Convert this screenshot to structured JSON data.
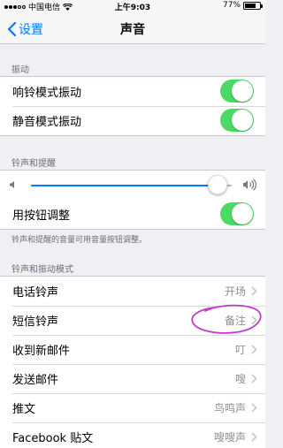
{
  "status_bar": {
    "carrier": "中国电信",
    "signal": "signal-dots-icon",
    "wifi": "wifi-icon",
    "time": "上午9:03",
    "battery_percent": "77%",
    "battery_level": 0.77
  },
  "nav": {
    "back_label": "设置",
    "title": "声音"
  },
  "vibrate": {
    "header": "振动",
    "items": [
      {
        "label": "响铃模式振动",
        "on": true
      },
      {
        "label": "静音模式振动",
        "on": true
      }
    ]
  },
  "ringer": {
    "header": "铃声和提醒",
    "volume_level": 0.93,
    "toggle_label": "用按钮调整",
    "toggle_on": true,
    "footer": "铃声和提醒的音量可用音量按钮调整。"
  },
  "patterns": {
    "header": "铃声和振动模式",
    "items": [
      {
        "label": "电话铃声",
        "value": "开场"
      },
      {
        "label": "短信铃声",
        "value": "备注"
      },
      {
        "label": "收到新邮件",
        "value": "叮"
      },
      {
        "label": "发送邮件",
        "value": "嗖"
      },
      {
        "label": "推文",
        "value": "鸟鸣声"
      },
      {
        "label": "Facebook 贴文",
        "value": "嗖嗖声"
      }
    ]
  },
  "colors": {
    "accent": "#007aff",
    "toggle_on": "#4cd964",
    "annotation": "#c33bc8"
  }
}
